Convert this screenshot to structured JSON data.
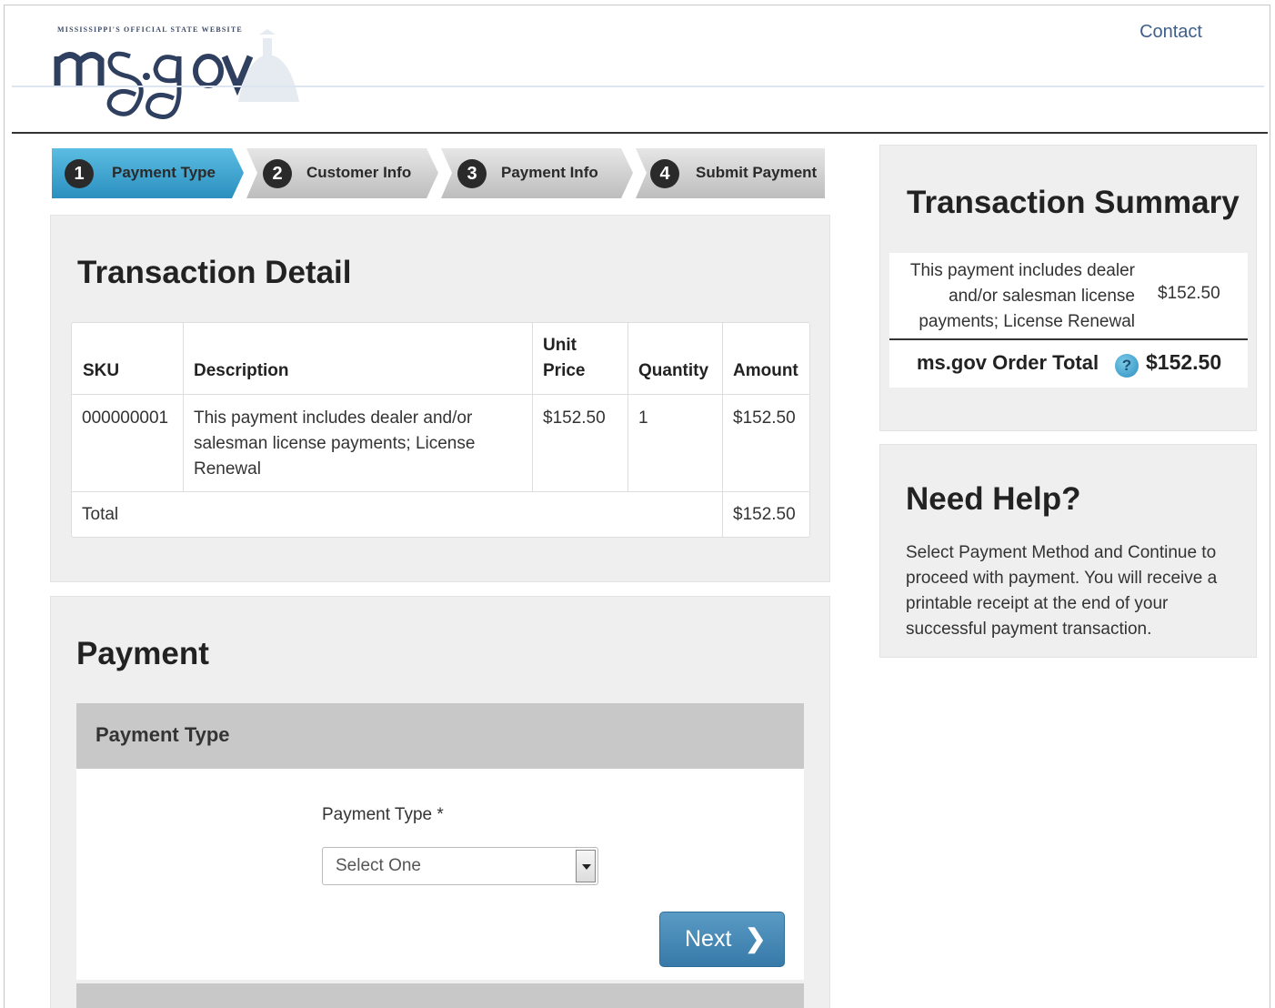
{
  "header": {
    "logo_tagline": "MISSISSIPPI'S OFFICIAL STATE WEBSITE",
    "logo_text": "ms.gov",
    "contact_label": "Contact"
  },
  "steps": [
    {
      "number": "1",
      "label": "Payment Type",
      "active": true
    },
    {
      "number": "2",
      "label": "Customer Info",
      "active": false
    },
    {
      "number": "3",
      "label": "Payment Info",
      "active": false
    },
    {
      "number": "4",
      "label": "Submit Payment",
      "active": false
    }
  ],
  "transaction_detail": {
    "title": "Transaction Detail",
    "columns": {
      "sku": "SKU",
      "description": "Description",
      "unit_price_line1": "Unit",
      "unit_price_line2": "Price",
      "quantity": "Quantity",
      "amount": "Amount"
    },
    "rows": [
      {
        "sku": "000000001",
        "description_lines": [
          "This payment includes dealer and/or",
          "salesman license payments; License",
          "Renewal"
        ],
        "unit_price": "$152.50",
        "quantity": "1",
        "amount": "$152.50"
      }
    ],
    "total_label": "Total",
    "total_amount": "$152.50"
  },
  "payment": {
    "title": "Payment",
    "section_title": "Payment Type",
    "field_label": "Payment Type *",
    "select_value": "Select One",
    "next_label": "Next",
    "next_icon": "chevron-right-icon"
  },
  "summary": {
    "title": "Transaction Summary",
    "item_lines": [
      "This payment includes dealer",
      "and/or salesman license",
      "payments; License Renewal"
    ],
    "item_amount": "$152.50",
    "order_total_label": "ms.gov Order Total",
    "help_icon_glyph": "?",
    "order_total_amount": "$152.50"
  },
  "help": {
    "title": "Need Help?",
    "text_lines": [
      "Select Payment Method and Continue to",
      "proceed with payment. You will receive a",
      "printable receipt at the end of your",
      "successful payment transaction."
    ]
  },
  "colors": {
    "active_step": "#3aa3cf",
    "inactive_step": "#d4d4d4",
    "next_button": "#4a8bbb",
    "contact_link": "#3e5f8a"
  }
}
